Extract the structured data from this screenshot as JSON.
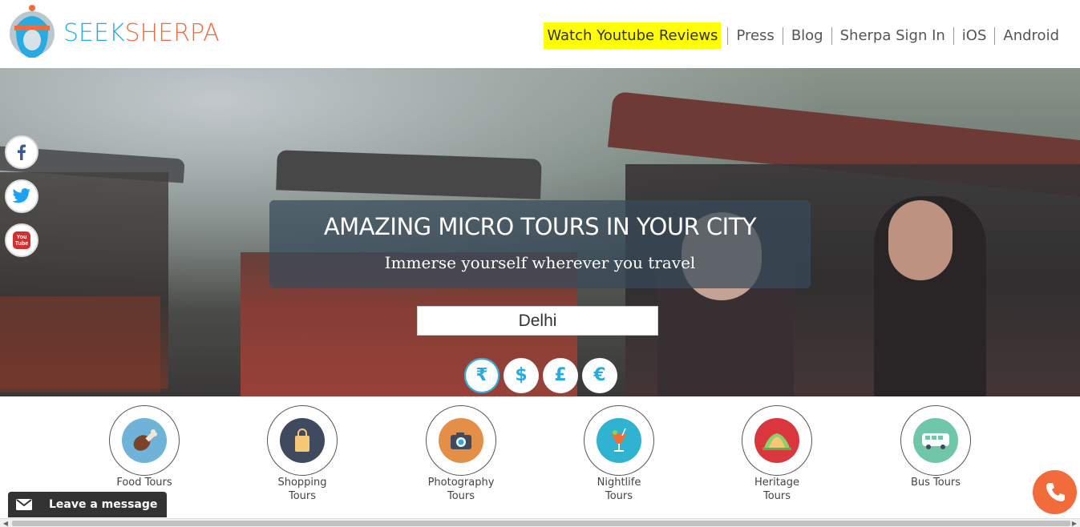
{
  "brand": {
    "seek": "SEEK",
    "sherpa": "SHERPA",
    "colors": {
      "seek": "#29abe2",
      "sherpa": "#f26b3a"
    }
  },
  "nav": {
    "items": [
      {
        "label": "Watch Youtube Reviews",
        "highlight": true
      },
      {
        "label": "Press"
      },
      {
        "label": "Blog"
      },
      {
        "label": "Sherpa Sign In"
      },
      {
        "label": "iOS"
      },
      {
        "label": "Android"
      }
    ],
    "highlight_color": "#ffff00"
  },
  "hero": {
    "title": "AMAZING MICRO TOURS IN YOUR CITY",
    "subtitle": "Immerse yourself wherever you travel",
    "city": "Delhi",
    "currencies": [
      {
        "symbol": "₹",
        "active": true
      },
      {
        "symbol": "$",
        "active": false
      },
      {
        "symbol": "£",
        "active": false
      },
      {
        "symbol": "€",
        "active": false
      }
    ]
  },
  "social": [
    {
      "name": "facebook-icon",
      "color": "#3b5998"
    },
    {
      "name": "twitter-icon",
      "color": "#1da1f2"
    },
    {
      "name": "youtube-icon",
      "color": "#d32f2f"
    }
  ],
  "categories": [
    {
      "label": "Food Tours",
      "icon": "drumstick-icon",
      "color": "#6fb3d9"
    },
    {
      "label": "Shopping\nTours",
      "icon": "shopping-bag-icon",
      "color": "#3f4a5e"
    },
    {
      "label": "Photography\nTours",
      "icon": "camera-icon",
      "color": "#e38f48"
    },
    {
      "label": "Nightlife\nTours",
      "icon": "cocktail-icon",
      "color": "#2fb3d0"
    },
    {
      "label": "Heritage\nTours",
      "icon": "lotus-temple-icon",
      "color": "#d9363e"
    },
    {
      "label": "Bus Tours",
      "icon": "bus-icon",
      "color": "#6fc6a9"
    }
  ],
  "chat": {
    "label": "Leave a message"
  },
  "call": {
    "icon": "phone-icon",
    "color": "#f26b3a"
  },
  "scroll": {
    "left": "◀",
    "right": "▶"
  }
}
